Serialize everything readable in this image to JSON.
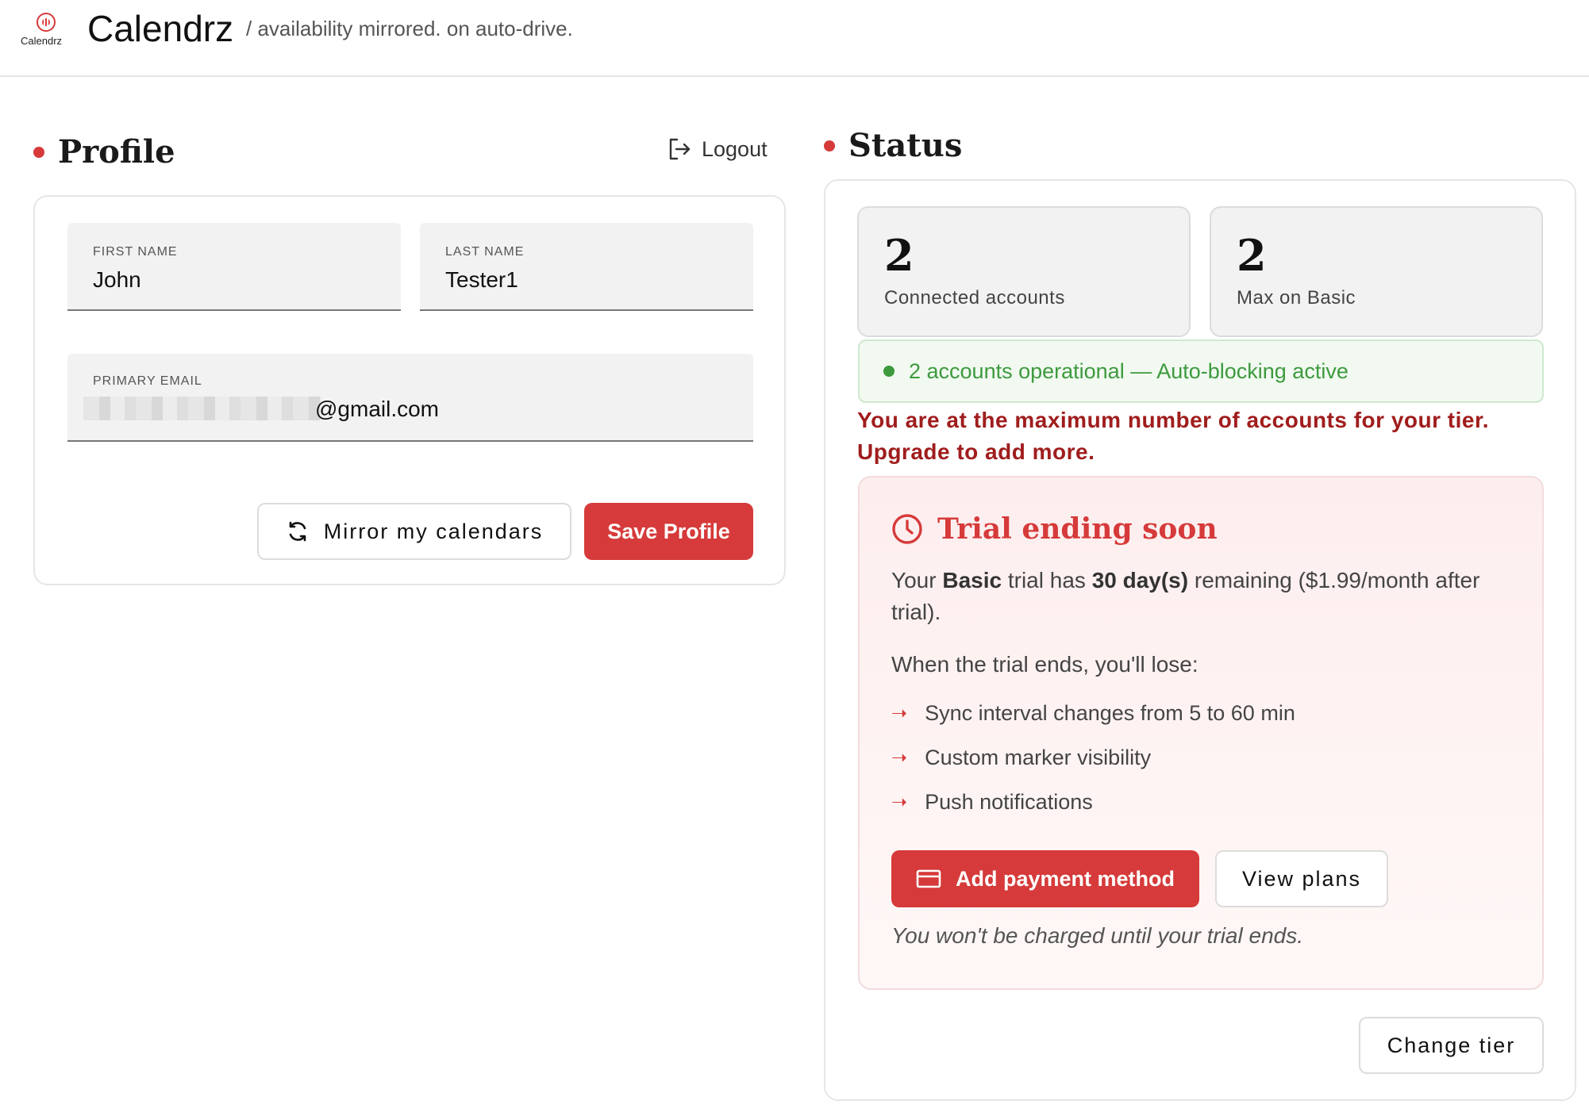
{
  "header": {
    "logo_text": "Calendrz",
    "app_title": "Calendrz",
    "tagline": "/ availability mirrored. on auto-drive."
  },
  "profile": {
    "title": "Profile",
    "logout_label": "Logout",
    "first_name_label": "FIRST NAME",
    "first_name_value": "John",
    "last_name_label": "LAST NAME",
    "last_name_value": "Tester1",
    "email_label": "PRIMARY EMAIL",
    "email_value": "@gmail.com",
    "mirror_button": "Mirror my calendars",
    "save_button": "Save Profile"
  },
  "status": {
    "title": "Status",
    "connected_count": "2",
    "connected_label": "Connected accounts",
    "max_count": "2",
    "max_label": "Max on Basic",
    "operational_text": "2 accounts operational — Auto-blocking active",
    "max_warning": "You are at the maximum number of accounts for your tier. Upgrade to add more.",
    "change_tier_button": "Change tier"
  },
  "trial": {
    "title": "Trial ending soon",
    "text_prefix": "Your ",
    "tier": "Basic",
    "text_mid": " trial has ",
    "days": "30 day(s)",
    "text_suffix": " remaining ($1.99/month after trial).",
    "lose_intro": "When the trial ends, you'll lose:",
    "losses": [
      "Sync interval changes from 5 to 60 min",
      "Custom marker visibility",
      "Push notifications"
    ],
    "add_payment_button": "Add payment method",
    "view_plans_button": "View plans",
    "note": "You won't be charged until your trial ends."
  },
  "colors": {
    "accent": "#d63a3a",
    "success": "#3d9a3d",
    "warning_text": "#a01d1d"
  }
}
